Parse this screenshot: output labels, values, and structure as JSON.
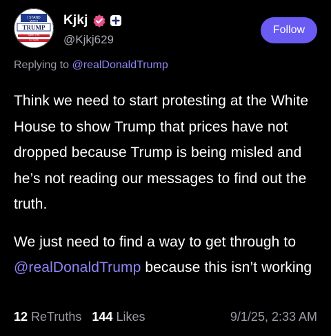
{
  "post": {
    "author": {
      "display_name": "Kjkj",
      "handle": "@Kjkj629",
      "avatar_text": [
        "I STAND",
        "WITH",
        "TRUMP",
        "SAVE THE",
        "TO SAVE"
      ],
      "verified_icon": "verified-badge-icon",
      "plus_icon": "plus-badge-icon"
    },
    "follow_label": "Follow",
    "replying_to": {
      "prefix": "Replying to",
      "mention": "@realDonaldTrump"
    },
    "body": {
      "paragraph1": "Think we need to start protesting at the White House to show Trump that prices have not dropped because Trump is being misled and he’s not reading our messages to find out the truth.",
      "paragraph2_before": "We just need to find a way to get through to",
      "paragraph2_mention": "@realDonaldTrump",
      "paragraph2_after": "because this isn’t working"
    },
    "stats": {
      "retruths_count": "12",
      "retruths_label": "ReTruths",
      "likes_count": "144",
      "likes_label": "Likes",
      "timestamp": "9/1/25, 2:33 AM"
    }
  },
  "colors": {
    "background": "#000000",
    "accent": "#6a5cf2",
    "mention": "#8f86f7",
    "muted_text": "#9a9aa6",
    "verified_badge": "#e8508a"
  }
}
